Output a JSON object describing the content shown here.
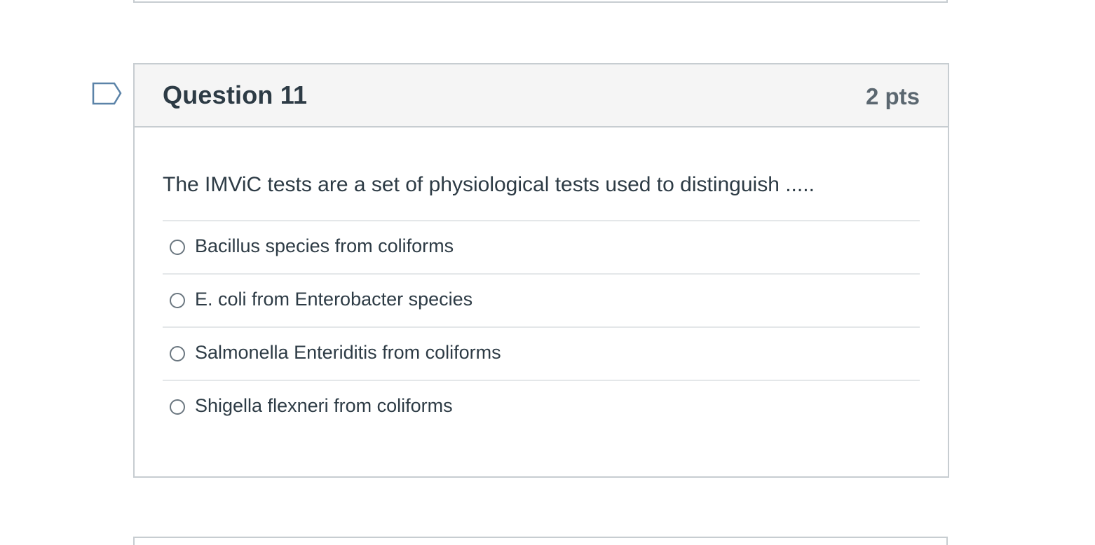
{
  "question": {
    "title": "Question 11",
    "points": "2 pts",
    "text": "The IMViC tests are a set of physiological tests used to distinguish .....",
    "flag_icon": "flag-question-icon",
    "answers": [
      {
        "label": "Bacillus species from coliforms"
      },
      {
        "label": "E. coli from Enterobacter species"
      },
      {
        "label": "Salmonella Enteriditis from coliforms"
      },
      {
        "label": "Shigella flexneri from coliforms"
      }
    ]
  },
  "colors": {
    "header_bg": "#f5f5f5",
    "border": "#c7cdd1",
    "text": "#2d3b45",
    "flag": "#5b83a8"
  }
}
